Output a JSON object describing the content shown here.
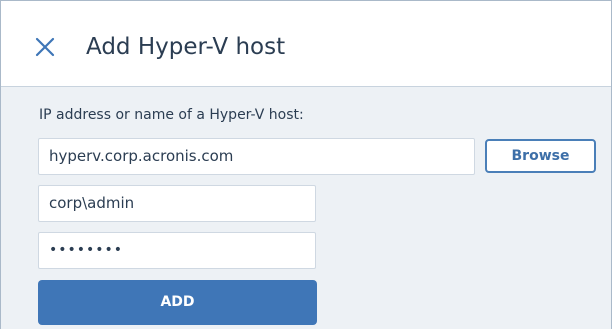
{
  "dialog": {
    "title": "Add Hyper-V host",
    "close_icon": "close-icon"
  },
  "form": {
    "host_label": "IP address or name of a Hyper-V host:",
    "host_value": "hyperv.corp.acronis.com",
    "browse_label": "Browse",
    "username_value": "corp\\admin",
    "password_value": "••••••••",
    "add_label": "ADD"
  },
  "colors": {
    "primary": "#3f76b7",
    "body_background": "#edf1f5",
    "text": "#2b3d52"
  }
}
